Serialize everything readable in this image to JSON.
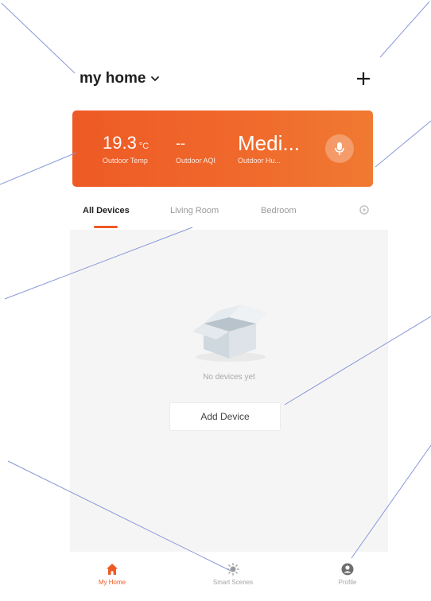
{
  "header": {
    "home_name": "my home",
    "chevron_icon": "chevron-down-icon",
    "add_icon": "plus-icon"
  },
  "weather": {
    "temperature": {
      "value": "19.3",
      "unit": "°C",
      "label": "Outdoor Temp"
    },
    "aqi": {
      "value": "--",
      "label": "Outdoor AQI"
    },
    "humidity": {
      "value": "Medi...",
      "label": "Outdoor Hu..."
    },
    "mic_icon": "microphone-icon",
    "accent": "#ef5a24"
  },
  "tabs": {
    "items": [
      {
        "label": "All Devices",
        "active": true
      },
      {
        "label": "Living Room",
        "active": false
      },
      {
        "label": "Bedroom",
        "active": false
      }
    ],
    "settings_icon": "gear-icon"
  },
  "content": {
    "empty_icon": "empty-box-icon",
    "empty_text": "No devices yet",
    "add_device_label": "Add Device"
  },
  "nav": {
    "items": [
      {
        "label": "My Home",
        "icon": "home-icon",
        "active": true
      },
      {
        "label": "Smart Scenes",
        "icon": "sun-icon",
        "active": false
      },
      {
        "label": "Profile",
        "icon": "profile-icon",
        "active": false
      }
    ],
    "active_color": "#ef5a24",
    "inactive_color": "#a4a4a4"
  }
}
